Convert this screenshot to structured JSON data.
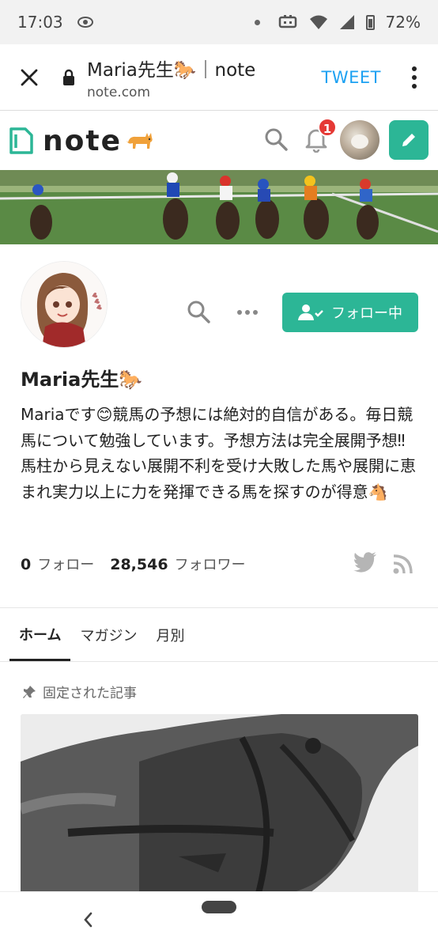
{
  "status_bar": {
    "time": "17:03",
    "battery": "72%"
  },
  "browser": {
    "title": "Maria先生🐎｜note",
    "url": "note.com",
    "tweet_label": "TWEET"
  },
  "header": {
    "logo_text": "note",
    "notification_count": "1"
  },
  "profile": {
    "name": "Maria先生🐎",
    "bio": "Mariaです😊競馬の予想には絶対的自信がある。毎日競馬について勉強しています。予想方法は完全展開予想‼︎馬柱から見えない展開不利を受け大敗した馬や展開に恵まれ実力以上に力を発揮できる馬を探すのが得意🐴",
    "follow_button": "フォロー中",
    "following_count": "0",
    "following_label": "フォロー",
    "followers_count": "28,546",
    "followers_label": "フォロワー"
  },
  "tabs": [
    {
      "label": "ホーム",
      "active": true
    },
    {
      "label": "マガジン",
      "active": false
    },
    {
      "label": "月別",
      "active": false
    }
  ],
  "pinned_label": "固定された記事",
  "colors": {
    "accent": "#2cb696",
    "tweet": "#1da1f2",
    "badge": "#e53935"
  }
}
